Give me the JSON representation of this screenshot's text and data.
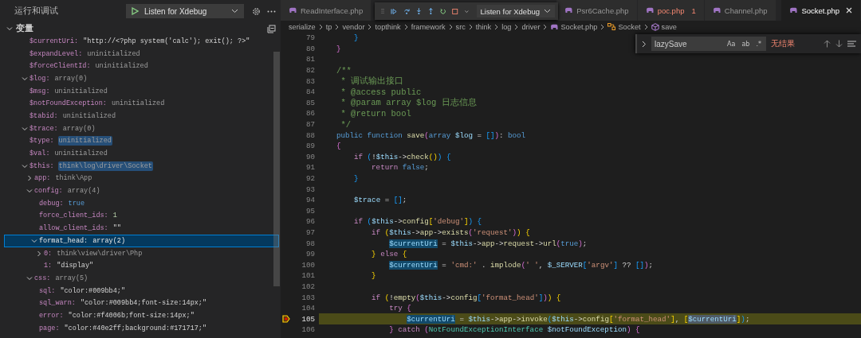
{
  "sidebar": {
    "title": "运行和调试",
    "launch_config": "Listen for Xdebug",
    "section": {
      "title": "变量",
      "expanded": true
    },
    "variables": [
      {
        "name": "$currentUri:",
        "value": "\"http://<?php system('calc'); exit(); ?>\"",
        "kind": "string",
        "selected": false,
        "highlighted": false
      },
      {
        "name": "$expandLevel:",
        "value": "uninitialized",
        "kind": "other",
        "selected": false,
        "highlighted": false
      },
      {
        "name": "$forceClientId:",
        "value": "uninitialized",
        "kind": "other",
        "selected": false,
        "highlighted": false
      },
      {
        "name": "$log:",
        "value": "array(0)",
        "kind": "other",
        "selected": false,
        "highlighted": false,
        "expanded": true
      },
      {
        "name": "$msg:",
        "value": "uninitialized",
        "kind": "other",
        "selected": false,
        "highlighted": false
      },
      {
        "name": "$notFoundException:",
        "value": "uninitialized",
        "kind": "other",
        "selected": false,
        "highlighted": false
      },
      {
        "name": "$tabid:",
        "value": "uninitialized",
        "kind": "other",
        "selected": false,
        "highlighted": false
      },
      {
        "name": "$trace:",
        "value": "array(0)",
        "kind": "other",
        "selected": false,
        "highlighted": false,
        "expanded": true
      },
      {
        "name": "$type:",
        "value": "uninitialized",
        "kind": "other",
        "selected": false,
        "highlighted": true
      },
      {
        "name": "$val:",
        "value": "uninitialized",
        "kind": "other",
        "selected": false,
        "highlighted": false
      },
      {
        "name": "$this:",
        "value": "think\\log\\driver\\Socket",
        "kind": "other",
        "selected": false,
        "highlighted": true,
        "expanded": true,
        "children": [
          {
            "name": "app:",
            "value": "think\\App",
            "kind": "other",
            "selected": false,
            "highlighted": false,
            "expanded": false
          },
          {
            "name": "config:",
            "value": "array(4)",
            "kind": "other",
            "selected": false,
            "highlighted": false,
            "expanded": true,
            "children": [
              {
                "name": "debug:",
                "value": "true",
                "kind": "boolean",
                "selected": false,
                "highlighted": false
              },
              {
                "name": "force_client_ids:",
                "value": "1",
                "kind": "number",
                "selected": false,
                "highlighted": false
              },
              {
                "name": "allow_client_ids:",
                "value": "\"\"",
                "kind": "string",
                "selected": false,
                "highlighted": false
              },
              {
                "name": "format_head:",
                "value": "array(2)",
                "kind": "other",
                "selected": true,
                "highlighted": false,
                "expanded": true,
                "children": [
                  {
                    "name": "0:",
                    "value": "think\\view\\driver\\Php",
                    "kind": "other",
                    "selected": false,
                    "highlighted": false,
                    "expanded": false
                  },
                  {
                    "name": "1:",
                    "value": "\"display\"",
                    "kind": "string",
                    "selected": false,
                    "highlighted": false
                  }
                ]
              }
            ]
          },
          {
            "name": "css:",
            "value": "array(5)",
            "kind": "other",
            "selected": false,
            "highlighted": false,
            "expanded": true,
            "children": [
              {
                "name": "sql:",
                "value": "\"color:#009bb4;\"",
                "kind": "string",
                "selected": false,
                "highlighted": false
              },
              {
                "name": "sql_warn:",
                "value": "\"color:#009bb4;font-size:14px;\"",
                "kind": "string",
                "selected": false,
                "highlighted": false
              },
              {
                "name": "error:",
                "value": "\"color:#f4006b;font-size:14px;\"",
                "kind": "string",
                "selected": false,
                "highlighted": false
              },
              {
                "name": "page:",
                "value": "\"color:#40e2ff;background:#171717;\"",
                "kind": "string",
                "selected": false,
                "highlighted": false
              }
            ]
          }
        ]
      }
    ]
  },
  "tabs": [
    {
      "label": "ReadInterface.php",
      "selected": false
    },
    {
      "label": "Psr6Cache.php",
      "selected": false
    },
    {
      "label": "poc.php",
      "selected": false,
      "problems": "1"
    },
    {
      "label": "Channel.php",
      "selected": false
    },
    {
      "label": "Socket.php",
      "selected": true
    }
  ],
  "debug_toolbar": {
    "config": "Listen for Xdebug"
  },
  "breadcrumbs": [
    {
      "label": "serialize",
      "kind": "folder"
    },
    {
      "label": "tp",
      "kind": "folder"
    },
    {
      "label": "vendor",
      "kind": "folder"
    },
    {
      "label": "topthink",
      "kind": "folder"
    },
    {
      "label": "framework",
      "kind": "folder"
    },
    {
      "label": "src",
      "kind": "folder"
    },
    {
      "label": "think",
      "kind": "folder"
    },
    {
      "label": "log",
      "kind": "folder"
    },
    {
      "label": "driver",
      "kind": "folder"
    },
    {
      "label": "Socket.php",
      "kind": "file"
    },
    {
      "label": "Socket",
      "kind": "class"
    },
    {
      "label": "save",
      "kind": "method"
    }
  ],
  "find": {
    "value": "lazySave",
    "options": [
      {
        "label": "Aa",
        "on": false
      },
      {
        "label": "ab",
        "on": false
      },
      {
        "label": ".*",
        "on": false
      }
    ],
    "result": "无结果"
  },
  "code_lines": [
    {
      "number": "79",
      "current": false,
      "tokens": [
        {
          "kind": "b3",
          "text": "    }"
        }
      ]
    },
    {
      "number": "80",
      "current": false,
      "tokens": [
        {
          "kind": "b2",
          "text": "}"
        }
      ]
    },
    {
      "number": "81",
      "current": false
    },
    {
      "number": "82",
      "current": false,
      "tokens": [
        {
          "kind": "cm",
          "text": "/**"
        }
      ]
    },
    {
      "number": "83",
      "current": false,
      "tokens": [
        {
          "kind": "cm",
          "text": " * 调试输出接口"
        }
      ]
    },
    {
      "number": "84",
      "current": false,
      "tokens": [
        {
          "kind": "cm",
          "text": " * @access public"
        }
      ]
    },
    {
      "number": "85",
      "current": false,
      "tokens": [
        {
          "kind": "cm",
          "text": " * @param array $log 日志信息"
        }
      ]
    },
    {
      "number": "86",
      "current": false,
      "tokens": [
        {
          "kind": "cm",
          "text": " * @return bool"
        }
      ]
    },
    {
      "number": "87",
      "current": false,
      "tokens": [
        {
          "kind": "cm",
          "text": " */"
        }
      ]
    },
    {
      "number": "88",
      "current": false,
      "tokens": [
        {
          "kind": "kw",
          "text": "public function "
        },
        {
          "kind": "fn",
          "text": "save"
        },
        {
          "kind": "b2",
          "text": "("
        },
        {
          "kind": "kw",
          "text": "array "
        },
        {
          "kind": "var",
          "text": "$log"
        },
        {
          "kind": "plain",
          "text": " = "
        },
        {
          "kind": "b3",
          "text": "[]"
        },
        {
          "kind": "b2",
          "text": ")"
        },
        {
          "kind": "plain",
          "text": ": "
        },
        {
          "kind": "kw",
          "text": "bool"
        }
      ]
    },
    {
      "number": "89",
      "current": false,
      "tokens": [
        {
          "kind": "b2",
          "text": "{"
        }
      ]
    },
    {
      "number": "90",
      "current": false,
      "tokens": [
        {
          "kind": "ctrl",
          "text": "    if "
        },
        {
          "kind": "b3",
          "text": "("
        },
        {
          "kind": "plain",
          "text": "!"
        },
        {
          "kind": "var",
          "text": "$this"
        },
        {
          "kind": "plain",
          "text": "->"
        },
        {
          "kind": "fn",
          "text": "check"
        },
        {
          "kind": "b1",
          "text": "()"
        },
        {
          "kind": "b3",
          "text": ") "
        },
        {
          "kind": "b3",
          "text": "{"
        }
      ]
    },
    {
      "number": "91",
      "current": false,
      "tokens": [
        {
          "kind": "ctrl",
          "text": "        return "
        },
        {
          "kind": "kw",
          "text": "false"
        },
        {
          "kind": "plain",
          "text": ";"
        }
      ]
    },
    {
      "number": "92",
      "current": false,
      "tokens": [
        {
          "kind": "b3",
          "text": "    }"
        }
      ]
    },
    {
      "number": "93",
      "current": false
    },
    {
      "number": "94",
      "current": false,
      "tokens": [
        {
          "kind": "var",
          "text": "    $trace"
        },
        {
          "kind": "plain",
          "text": " = "
        },
        {
          "kind": "b3",
          "text": "[]"
        },
        {
          "kind": "plain",
          "text": ";"
        }
      ]
    },
    {
      "number": "95",
      "current": false
    },
    {
      "number": "96",
      "current": false,
      "tokens": [
        {
          "kind": "ctrl",
          "text": "    if "
        },
        {
          "kind": "b3",
          "text": "("
        },
        {
          "kind": "var",
          "text": "$this"
        },
        {
          "kind": "plain",
          "text": "->"
        },
        {
          "kind": "fn",
          "text": "config"
        },
        {
          "kind": "b1",
          "text": "["
        },
        {
          "kind": "str",
          "text": "'debug'"
        },
        {
          "kind": "b1",
          "text": "]"
        },
        {
          "kind": "b3",
          "text": ") "
        },
        {
          "kind": "b3",
          "text": "{"
        }
      ]
    },
    {
      "number": "97",
      "current": false,
      "tokens": [
        {
          "kind": "ctrl",
          "text": "        if "
        },
        {
          "kind": "b1",
          "text": "("
        },
        {
          "kind": "var",
          "text": "$this"
        },
        {
          "kind": "plain",
          "text": "->"
        },
        {
          "kind": "fn",
          "text": "app"
        },
        {
          "kind": "plain",
          "text": "->"
        },
        {
          "kind": "fn",
          "text": "exists"
        },
        {
          "kind": "b2",
          "text": "("
        },
        {
          "kind": "str",
          "text": "'request'"
        },
        {
          "kind": "b2",
          "text": ")"
        },
        {
          "kind": "b1",
          "text": ") "
        },
        {
          "kind": "b1",
          "text": "{"
        }
      ]
    },
    {
      "number": "98",
      "current": false,
      "tokens": [
        {
          "kind": "hl",
          "text": "            $currentUri"
        },
        {
          "kind": "plain",
          "text": " = "
        },
        {
          "kind": "var",
          "text": "$this"
        },
        {
          "kind": "plain",
          "text": "->"
        },
        {
          "kind": "fn",
          "text": "app"
        },
        {
          "kind": "plain",
          "text": "->"
        },
        {
          "kind": "fn",
          "text": "request"
        },
        {
          "kind": "plain",
          "text": "->"
        },
        {
          "kind": "fn",
          "text": "url"
        },
        {
          "kind": "b2",
          "text": "("
        },
        {
          "kind": "kw",
          "text": "true"
        },
        {
          "kind": "b2",
          "text": ")"
        },
        {
          "kind": "plain",
          "text": ";"
        }
      ]
    },
    {
      "number": "99",
      "current": false,
      "tokens": [
        {
          "kind": "b1",
          "text": "        }"
        },
        {
          "kind": "ctrl",
          "text": " else "
        },
        {
          "kind": "b1",
          "text": "{"
        }
      ]
    },
    {
      "number": "100",
      "current": false,
      "tokens": [
        {
          "kind": "hl",
          "text": "            $currentUri"
        },
        {
          "kind": "plain",
          "text": " = "
        },
        {
          "kind": "str",
          "text": "'cmd:'"
        },
        {
          "kind": "plain",
          "text": " . "
        },
        {
          "kind": "fn",
          "text": "implode"
        },
        {
          "kind": "b2",
          "text": "("
        },
        {
          "kind": "str",
          "text": "' '"
        },
        {
          "kind": "plain",
          "text": ", "
        },
        {
          "kind": "var",
          "text": "$_SERVER"
        },
        {
          "kind": "b3",
          "text": "["
        },
        {
          "kind": "str",
          "text": "'argv'"
        },
        {
          "kind": "b3",
          "text": "]"
        },
        {
          "kind": "plain",
          "text": " ?? "
        },
        {
          "kind": "b3",
          "text": "[]"
        },
        {
          "kind": "b2",
          "text": ")"
        },
        {
          "kind": "plain",
          "text": ";"
        }
      ]
    },
    {
      "number": "101",
      "current": false,
      "tokens": [
        {
          "kind": "b1",
          "text": "        }"
        }
      ]
    },
    {
      "number": "102",
      "current": false
    },
    {
      "number": "103",
      "current": false,
      "tokens": [
        {
          "kind": "ctrl",
          "text": "        if "
        },
        {
          "kind": "b1",
          "text": "("
        },
        {
          "kind": "plain",
          "text": "!"
        },
        {
          "kind": "fn",
          "text": "empty"
        },
        {
          "kind": "b2",
          "text": "("
        },
        {
          "kind": "var",
          "text": "$this"
        },
        {
          "kind": "plain",
          "text": "->"
        },
        {
          "kind": "fn",
          "text": "config"
        },
        {
          "kind": "b3",
          "text": "["
        },
        {
          "kind": "str",
          "text": "'format_head'"
        },
        {
          "kind": "b3",
          "text": "]"
        },
        {
          "kind": "b2",
          "text": ")"
        },
        {
          "kind": "b1",
          "text": ") "
        },
        {
          "kind": "b1",
          "text": "{"
        }
      ]
    },
    {
      "number": "104",
      "current": false,
      "tokens": [
        {
          "kind": "ctrl",
          "text": "            try "
        },
        {
          "kind": "b2",
          "text": "{"
        }
      ]
    },
    {
      "number": "105",
      "current": true,
      "tokens": [
        {
          "kind": "hl",
          "text": "                $currentUri"
        },
        {
          "kind": "plain",
          "text": " = "
        },
        {
          "kind": "var",
          "text": "$this"
        },
        {
          "kind": "plain",
          "text": "->"
        },
        {
          "kind": "fn",
          "text": "app"
        },
        {
          "kind": "plain",
          "text": "->"
        },
        {
          "kind": "fn",
          "text": "invoke"
        },
        {
          "kind": "b3",
          "text": "("
        },
        {
          "kind": "var",
          "text": "$this"
        },
        {
          "kind": "plain",
          "text": "->"
        },
        {
          "kind": "fn",
          "text": "config"
        },
        {
          "kind": "b1",
          "text": "["
        },
        {
          "kind": "str",
          "text": "'format_head'"
        },
        {
          "kind": "b1",
          "text": "]"
        },
        {
          "kind": "plain",
          "text": ", "
        },
        {
          "kind": "b1",
          "text": "["
        },
        {
          "kind": "hl2",
          "text": "$currentUri"
        },
        {
          "kind": "b1",
          "text": "]"
        },
        {
          "kind": "b3",
          "text": ")"
        },
        {
          "kind": "plain",
          "text": ";"
        }
      ]
    },
    {
      "number": "106",
      "current": false,
      "tokens": [
        {
          "kind": "b2",
          "text": "            }"
        },
        {
          "kind": "ctrl",
          "text": " catch "
        },
        {
          "kind": "b2",
          "text": "("
        },
        {
          "kind": "type",
          "text": "NotFoundExceptionInterface "
        },
        {
          "kind": "var",
          "text": "$notFoundException"
        },
        {
          "kind": "b2",
          "text": ") "
        },
        {
          "kind": "b2",
          "text": "{"
        }
      ]
    }
  ]
}
